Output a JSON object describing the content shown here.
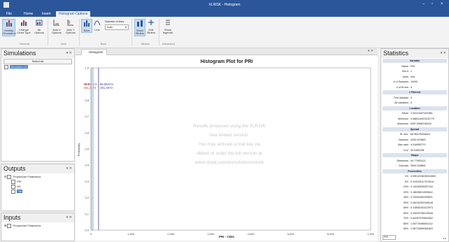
{
  "window": {
    "title": "XLRISK - Histogram"
  },
  "tabs": [
    "File",
    "Home",
    "Insert",
    "Histogram Options"
  ],
  "ribbon": {
    "buttons": [
      {
        "label": "Overlay\nSimulation",
        "icon": "overlay-icon"
      },
      {
        "label": "Change\nChart Type",
        "icon": "chart-type-icon"
      },
      {
        "label": "All\nOptions",
        "icon": "options-icon"
      },
      {
        "label": "Axis X\nOptions",
        "icon": "axis-x-icon"
      },
      {
        "label": "Axis Y\nOptions",
        "icon": "axis-y-icon"
      },
      {
        "label": "Bars",
        "icon": "bars-icon"
      },
      {
        "label": "Line",
        "icon": "line-icon"
      },
      {
        "label": "Show\nSliders",
        "icon": "sliders-icon"
      },
      {
        "label": "Edit\nSliders",
        "icon": "edit-sliders-icon"
      },
      {
        "label": "Show\nlegends",
        "icon": "legend-icon"
      }
    ],
    "bins_label": "Number of bins",
    "bins_value": "Auto",
    "groups": [
      "General",
      "Axis",
      "Bars",
      "Sliders",
      "Advanced"
    ]
  },
  "simulations": {
    "title": "Simulations",
    "select_all": "Select All",
    "item": "Simulation #1"
  },
  "outputs": {
    "title": "Outputs",
    "root": "Proyección Financiera",
    "items": [
      "FRI",
      "VH",
      "TIR"
    ]
  },
  "inputs": {
    "title": "Inputs",
    "root": "Proyección Financiera"
  },
  "chart_tab": "Histogram",
  "chart_data": {
    "type": "bar",
    "title": "Histogram Plot for PRI",
    "xlabel": "PRI - C$51",
    "ylabel": "Probability",
    "x_ticks": [
      "0",
      "1,000",
      "2,000",
      "3,000",
      "4,000",
      "5,000",
      "6,000",
      "7,000"
    ],
    "y_ticks": [
      "0.0",
      "0.1",
      "0.2",
      "0.3",
      "0.4",
      "0.5",
      "0.6",
      "0.7",
      "0.8",
      "0.9",
      "1.0"
    ],
    "xlim": [
      0,
      7000
    ],
    "ylim": [
      0,
      1.0
    ],
    "bars": [
      {
        "x0": 0,
        "x1": 60,
        "value": 0.999
      }
    ],
    "sliders": [
      {
        "x": 0,
        "pct": "99.9601%"
      },
      {
        "x": 191.2573,
        "pct": "99.9601%"
      }
    ],
    "slider_values": [
      "191.2573",
      "191.2573"
    ],
    "colors": {
      "bar": "#c9dcee",
      "slider_left": "#c0392b",
      "slider_right": "#3d3d9c"
    }
  },
  "watermark": [
    "Results produced using the XLRISK",
    "free limited version.",
    "You may activate a trial key via",
    "ribbon or order the full version at",
    "www.xlstat.com/en/solutions/xlrisk"
  ],
  "statistics": {
    "title": "Statistics",
    "rows": [
      {
        "k": "Variable",
        "sec": true
      },
      {
        "k": "Name",
        "v": "PRI"
      },
      {
        "k": "Sim #",
        "v": "1"
      },
      {
        "k": "Units",
        "v": "N/A"
      },
      {
        "k": "# of Samples",
        "v": "10000"
      },
      {
        "k": "# of Errors",
        "v": "0"
      },
      {
        "k": "# Filtered",
        "sec": true
      },
      {
        "k": "This Variable",
        "v": "0"
      },
      {
        "k": "All variables",
        "v": "0"
      },
      {
        "k": "Location",
        "sec": true
      },
      {
        "k": "Mean",
        "v": "2.03131697467881"
      },
      {
        "k": "Minimum",
        "v": "0.568414623151779"
      },
      {
        "k": "Maximum",
        "v": "6307.5968748243"
      },
      {
        "k": "Spread",
        "sec": true
      },
      {
        "k": "St. dev.",
        "v": "65.96475026624"
      },
      {
        "k": "Variance",
        "v": "4233.422869"
      },
      {
        "k": "Max ratio",
        "v": "4.918955770"
      },
      {
        "k": "CoV",
        "v": "32.0360208"
      },
      {
        "k": "Shape",
        "sec": true
      },
      {
        "k": "Skewness",
        "v": "94.77953113"
      },
      {
        "k": "Kurtosis",
        "v": "9094.318684"
      },
      {
        "k": "Percentiles",
        "sec": true
      },
      {
        "k": "1%",
        "v": "0.0901224836914650"
      },
      {
        "k": "5%",
        "v": "0.115249117072614"
      },
      {
        "k": "15%",
        "v": "0.14916535287163"
      },
      {
        "k": "25%",
        "v": "0.18639811909844"
      },
      {
        "k": "35%",
        "v": "0.23263462059621"
      },
      {
        "k": "45%",
        "v": "0.28216302348148"
      },
      {
        "k": "55%",
        "v": "0.31805240222973"
      },
      {
        "k": "65%",
        "v": "0.44933798125168"
      },
      {
        "k": "75%",
        "v": "0.63287579564362"
      },
      {
        "k": "85%",
        "v": "1.06774948651142"
      },
      {
        "k": "95%",
        "v": "2.08724895381603"
      }
    ],
    "footer_select": "PRI"
  }
}
